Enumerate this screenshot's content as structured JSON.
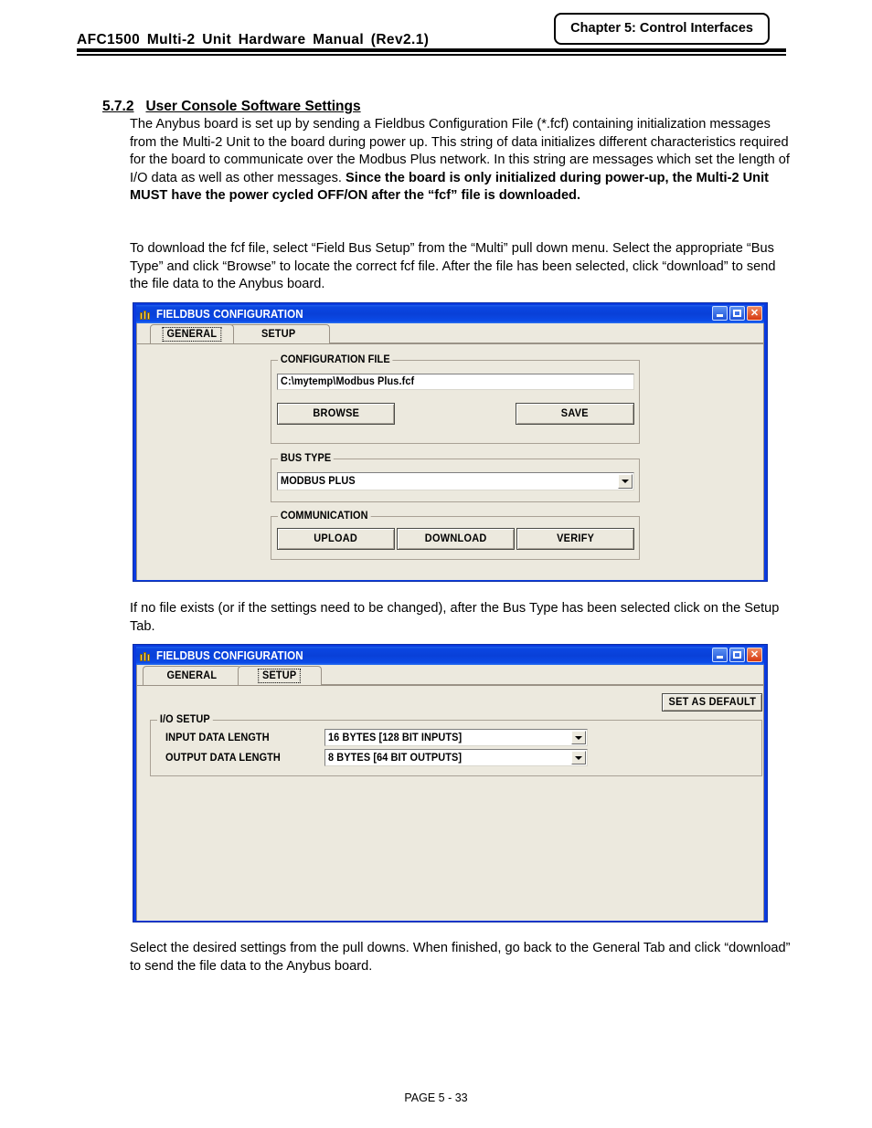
{
  "header": {
    "doc_title": "AFC1500  Multi-2  Unit  Hardware  Manual  (Rev2.1)",
    "chapter_label": "Chapter 5: Control Interfaces"
  },
  "section": {
    "number": "5.7.2",
    "title": "User Console Software Settings"
  },
  "paragraphs": {
    "intro_plain": "The Anybus board is set up by sending a Fieldbus Configuration File (*.fcf) containing initialization messages from the Multi-2 Unit to the board during power up. This string of data initializes different characteristics required for the board to communicate over the Modbus Plus network. In this string are messages which set the length of I/O data as well as other messages. ",
    "intro_bold": "Since the board is only initialized during power-up, the Multi-2 Unit MUST have the power cycled OFF/ON after the “fcf” file is downloaded.",
    "download": "To download the fcf file, select “Field Bus Setup” from the “Multi” pull down menu. Select the appropriate “Bus Type” and click “Browse” to locate the correct fcf file. After the file has been selected, click “download” to send the file data to the Anybus board.",
    "no_file": "If no file exists (or if the settings need to be changed), after the Bus Type has been selected click on the Setup Tab.",
    "final": "Select the desired settings from the pull downs. When finished, go back to the General Tab and click “download” to send the file data to the Anybus board."
  },
  "footer": {
    "page_label": "PAGE 5 - 33"
  },
  "dialog_general": {
    "title": "FIELDBUS CONFIGURATION",
    "window_buttons": {
      "minimize": "minimize-button",
      "maximize": "maximize-button",
      "close": "close-button"
    },
    "tabs": [
      {
        "label": "GENERAL",
        "active": true,
        "focused": true
      },
      {
        "label": "SETUP",
        "active": false,
        "focused": false
      }
    ],
    "config_file_group": {
      "legend": "CONFIGURATION FILE",
      "path_value": "C:\\mytemp\\Modbus Plus.fcf",
      "browse_label": "BROWSE",
      "save_label": "SAVE"
    },
    "bus_type_group": {
      "legend": "BUS TYPE",
      "selected": "MODBUS PLUS"
    },
    "communication_group": {
      "legend": "COMMUNICATION",
      "upload_label": "UPLOAD",
      "download_label": "DOWNLOAD",
      "verify_label": "VERIFY"
    }
  },
  "dialog_setup": {
    "title": "FIELDBUS CONFIGURATION",
    "tabs": [
      {
        "label": "GENERAL",
        "active": false,
        "focused": false
      },
      {
        "label": "SETUP",
        "active": true,
        "focused": true
      }
    ],
    "set_as_default_label": "SET AS DEFAULT",
    "io_setup_group": {
      "legend": "I/O SETUP",
      "input_label": "INPUT DATA LENGTH",
      "input_value": "16 BYTES [128 BIT INPUTS]",
      "output_label": "OUTPUT DATA LENGTH",
      "output_value": "8 BYTES [64 BIT OUTPUTS]"
    }
  },
  "colors": {
    "titlebar_blue": "#0a46e2",
    "window_frame": "#0a3ae0",
    "client_beige": "#ece9de",
    "close_red": "#d63a12"
  }
}
